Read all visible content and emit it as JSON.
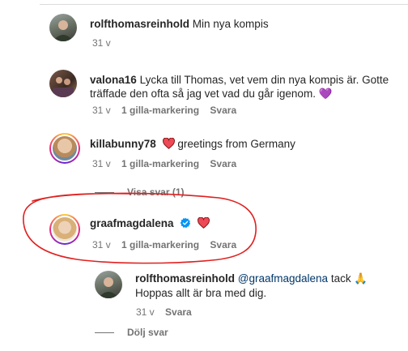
{
  "comments": [
    {
      "username": "rolfthomasreinhold",
      "text": "Min nya kompis",
      "time": "31 v"
    },
    {
      "username": "valona16",
      "text_line1": "Lycka till Thomas, vet vem din nya kompis är. Gotte",
      "text_line2": "träffade den ofta så jag vet vad du går igenom.",
      "emoji": "💜",
      "time": "31 v",
      "likes": "1 gilla-markering",
      "reply": "Svara"
    },
    {
      "username": "killabunny78",
      "emoji": "❤️",
      "text": "greetings from Germany",
      "time": "31 v",
      "likes": "1 gilla-markering",
      "reply": "Svara",
      "show_replies": "Visa svar (1)"
    },
    {
      "username": "graafmagdalena",
      "emoji": "❤️",
      "time": "31 v",
      "likes": "1 gilla-markering",
      "reply": "Svara"
    }
  ],
  "reply": {
    "username": "rolfthomasreinhold",
    "mention": "@graafmagdalena",
    "text_line1": "tack",
    "emoji": "🙏",
    "text_line2": "Hoppas allt är bra med dig.",
    "time": "31 v",
    "reply": "Svara",
    "hide_replies": "Dölj svar"
  },
  "colors": {
    "text": "#262626",
    "secondary": "#737373",
    "mention": "#00376b",
    "heart": "#ed4956",
    "verified": "#0095f6",
    "annotation": "#e02020"
  },
  "icons": [
    "verified-badge-icon",
    "red-heart-icon",
    "purple-heart-icon",
    "praying-hands-icon"
  ]
}
